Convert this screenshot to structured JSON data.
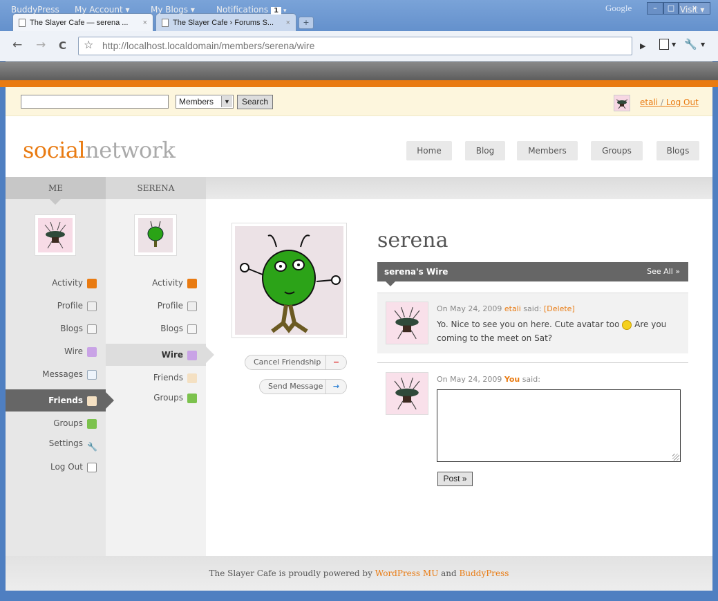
{
  "browser": {
    "tabs": [
      {
        "title": "The Slayer Cafe — serena ...",
        "close": "×"
      },
      {
        "title": "The Slayer Cafe › Forums S...",
        "close": "×"
      }
    ],
    "new_tab": "+",
    "brand": "Google",
    "url_host": "http://localhost.localdomain",
    "url_path": "/members/serena/wire",
    "back": "←",
    "forward": "→",
    "reload": "C",
    "star": "☆",
    "play": "▶",
    "page_menu": "▼",
    "tools_menu": "▼",
    "win_min": "–",
    "win_max": "□",
    "win_close": "x"
  },
  "adminbar": {
    "brand": "BuddyPress",
    "my_account": "My Account ▾",
    "my_blogs": "My Blogs ▾",
    "notifications": "Notifications",
    "notifications_count": "1",
    "visit": "Visit ▾"
  },
  "search": {
    "placeholder": "",
    "scope": "Members",
    "button": "Search"
  },
  "user": {
    "name": "etali",
    "separator": "/",
    "logout": "Log Out"
  },
  "site": {
    "logo_accent": "social",
    "logo_rest": "network",
    "nav": [
      "Home",
      "Blog",
      "Members",
      "Groups",
      "Blogs"
    ]
  },
  "left_column": {
    "header": "ME",
    "items": [
      "Activity",
      "Profile",
      "Blogs",
      "Wire",
      "Messages",
      "Friends",
      "Groups",
      "Settings",
      "Log Out"
    ],
    "selected": "Friends"
  },
  "mid_column": {
    "header": "SERENA",
    "items": [
      "Activity",
      "Profile",
      "Blogs",
      "Wire",
      "Friends",
      "Groups"
    ],
    "selected": "Wire"
  },
  "profile": {
    "name": "serena",
    "cancel_friendship": "Cancel Friendship",
    "cancel_icon": "−",
    "send_message": "Send Message",
    "send_icon": "→"
  },
  "wire": {
    "title": "serena's Wire",
    "see_all": "See All »",
    "post": {
      "date_prefix": "On May 24, 2009",
      "author": "etali",
      "said": "said:",
      "delete": "[Delete]",
      "text_before": "Yo. Nice to see you on here. Cute avatar too",
      "text_after": "Are you coming to the meet on Sat?"
    },
    "form": {
      "date_prefix": "On May 24, 2009",
      "author": "You",
      "said": "said:",
      "post_button": "Post »"
    }
  },
  "footer": {
    "prefix": "The Slayer Cafe is proudly powered by",
    "link1": "WordPress MU",
    "and": "and",
    "link2": "BuddyPress"
  },
  "colors": {
    "accent": "#e97b12",
    "chrome": "#4f7fc1",
    "adminbar": "#5d5d5d"
  }
}
